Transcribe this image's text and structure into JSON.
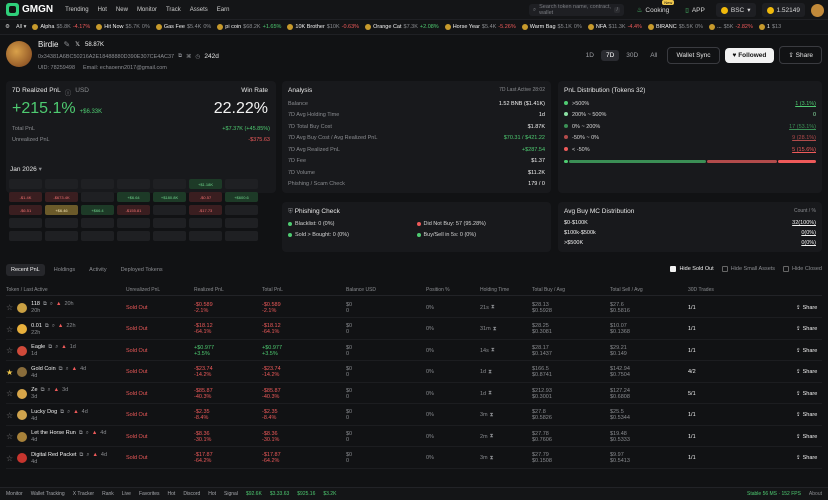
{
  "nav": {
    "brand": "GMGN",
    "links": [
      "Trending",
      "Hot",
      "New",
      "Monitor",
      "Track",
      "Assets",
      "Earn"
    ],
    "search_placeholder": "Search token name, contract, wallet",
    "search_shortcut": "/",
    "cooking_label": "Cooking",
    "cooking_badge": "New",
    "app_label": "APP",
    "chain": "BSC",
    "balance": "1.52149"
  },
  "ticker": {
    "filter_label": "All",
    "items": [
      {
        "name": "Alpha",
        "mc": "$5.8K",
        "chg": "-4.17%",
        "dir": "down"
      },
      {
        "name": "Hit Now",
        "mc": "$5.7K",
        "chg": "0%",
        "dir": "flat"
      },
      {
        "name": "Gas Fee",
        "mc": "$5.4K",
        "chg": "0%",
        "dir": "flat"
      },
      {
        "name": "pi coin",
        "mc": "$68.2K",
        "chg": "+1.65%",
        "dir": "up"
      },
      {
        "name": "10K Brother",
        "mc": "$10K",
        "chg": "-0.63%",
        "dir": "down"
      },
      {
        "name": "Orange Cat",
        "mc": "$7.3K",
        "chg": "+2.08%",
        "dir": "up"
      },
      {
        "name": "Horse Year",
        "mc": "$5.4K",
        "chg": "-5.26%",
        "dir": "down"
      },
      {
        "name": "Warm Bag",
        "mc": "$5.1K",
        "chg": "0%",
        "dir": "flat"
      },
      {
        "name": "NFA",
        "mc": "$11.3K",
        "chg": "-4.4%",
        "dir": "down"
      },
      {
        "name": "BIRANC",
        "mc": "$5.5K",
        "chg": "0%",
        "dir": "flat"
      },
      {
        "name": "...",
        "mc": "$5K",
        "chg": "-2.82%",
        "dir": "down"
      },
      {
        "name": "1",
        "mc": "$13",
        "chg": "",
        "dir": "flat"
      }
    ]
  },
  "profile": {
    "name": "Birdie",
    "followers": "58.87K",
    "age": "242d",
    "address": "0x34381A6BC50216A2E18488880D390E307CE4AC37",
    "uid": "UID: 78259498",
    "email": "Email: echaoenn2017@gmail.com",
    "timeframes": [
      "1D",
      "7D",
      "30D",
      "All"
    ],
    "tf_active": "7D",
    "wallet_sync_label": "Wallet Sync",
    "followed_label": "Followed",
    "share_label": "Share"
  },
  "pnl": {
    "title": "7D Realized PnL",
    "currency": "USD",
    "winrate_label": "Win Rate",
    "pct": "+215.1%",
    "usd": "+$6.33K",
    "winrate": "22.22%",
    "total_label": "Total PnL",
    "total_value": "+$7.37K (+45.85%)",
    "unreal_label": "Unrealized PnL",
    "unreal_value": "-$375.63"
  },
  "calendar": {
    "month": "Jan 2026",
    "cells": [
      "",
      "",
      "",
      "",
      "",
      "+$1.18K",
      "",
      "-$1.4K",
      "-$673.4K",
      "",
      "+$6.64",
      "+$180.8K",
      "-$0.57",
      "+$600.6",
      "-$6.51",
      "+$6.46",
      "+$66.4",
      "-$155.81",
      "",
      "-$17.73",
      "",
      "",
      "",
      "",
      "",
      "",
      "",
      "",
      "",
      "",
      "",
      "",
      "",
      "",
      ""
    ]
  },
  "analysis": {
    "title": "Analysis",
    "tf_label": "7D",
    "last_active": "Last Active 28:02",
    "rows": [
      {
        "label": "Balance",
        "value": "1.52 BNB ($1.41K)"
      },
      {
        "label": "7D Avg Holding Time",
        "value": "1d"
      },
      {
        "label": "7D Total Buy Cost",
        "value": "$1.87K"
      },
      {
        "label": "7D Avg Buy Cost / Avg Realized PnL",
        "value": "$70.31 / $421.22"
      },
      {
        "label": "7D Avg Realized PnL",
        "value": "+$287.54"
      },
      {
        "label": "7D Fee",
        "value": "$1.37"
      },
      {
        "label": "7D Volume",
        "value": "$11.2K"
      },
      {
        "label": "Phishing / Scam Check",
        "value": "179 / 0"
      }
    ]
  },
  "distribution": {
    "title": "PnL Distribution (Tokens 32)",
    "rows": [
      {
        "label": ">500%",
        "value": "1 (3.1%)",
        "color": "#4ecb71"
      },
      {
        "label": "200% ~ 500%",
        "value": "0",
        "color": "#8be0a3"
      },
      {
        "label": "0% ~ 200%",
        "value": "17 (53.1%)",
        "color": "#3b8f55"
      },
      {
        "label": "-50% ~ 0%",
        "value": "9 (28.1%)",
        "color": "#b24b4b"
      },
      {
        "label": "< -50%",
        "value": "5 (15.6%)",
        "color": "#ee5a5a"
      }
    ]
  },
  "phishing": {
    "title": "Phishing Check",
    "items": [
      {
        "label": "Blacklist: 0 (0%)",
        "color": "#4ecb71"
      },
      {
        "label": "Did Not Buy: 57 (95.28%)",
        "color": "#ee5a5a"
      },
      {
        "label": "Sold > Bought: 0 (0%)",
        "color": "#4ecb71"
      },
      {
        "label": "Buy/Sell in 5s: 0 (0%)",
        "color": "#4ecb71"
      }
    ]
  },
  "avgbuy": {
    "title": "Avg Buy MC Distribution",
    "count_label": "Count / %",
    "rows": [
      {
        "label": "$0-$100K",
        "value": "32(100%)"
      },
      {
        "label": "$100k-$500k",
        "value": "0(0%)"
      },
      {
        "label": ">$500K",
        "value": "0(0%)"
      }
    ]
  },
  "tabs": [
    "Recent PnL",
    "Holdings",
    "Activity",
    "Deployed Tokens"
  ],
  "filters": [
    "Hide Sold Out",
    "Hide Small Assets",
    "Hide Closed"
  ],
  "table": {
    "headers": [
      "Token / Last Active",
      "Unrealized PnL",
      "Realized PnL",
      "Total PnL",
      "Balance USD",
      "Position %",
      "Holding Time",
      "Total Buy / Avg",
      "Total Sell / Avg",
      "30D Trades",
      ""
    ],
    "rows": [
      {
        "name": "118",
        "age": "20h",
        "t": "20h",
        "unreal": "Sold Out",
        "real": "-$0.589",
        "real_pct": "-2.1%",
        "total": "-$0.589",
        "total_pct": "-2.1%",
        "bal": "$0",
        "bal2": "0",
        "pos": "0%",
        "hold": "21s",
        "buy": "$28.13",
        "buy_avg": "$0.5928",
        "sell": "$27.6",
        "sell_avg": "$0.5816",
        "trades": "1/1",
        "color": "#c9a043",
        "star": false
      },
      {
        "name": "0.01",
        "age": "22h",
        "t": "22h",
        "unreal": "Sold Out",
        "real": "-$18.12",
        "real_pct": "-64.1%",
        "total": "-$18.12",
        "total_pct": "-64.1%",
        "bal": "$0",
        "bal2": "0",
        "pos": "0%",
        "hold": "31m",
        "buy": "$28.25",
        "buy_avg": "$0.3081",
        "sell": "$10.07",
        "sell_avg": "$0.1368",
        "trades": "1/1",
        "color": "#e8b03c",
        "star": false
      },
      {
        "name": "Eagle",
        "age": "1d",
        "t": "1d",
        "unreal": "Sold Out",
        "real": "+$0.977",
        "real_pct": "+3.5%",
        "total": "+$0.977",
        "total_pct": "+3.5%",
        "bal": "$0",
        "bal2": "0",
        "pos": "0%",
        "hold": "14s",
        "buy": "$28.17",
        "buy_avg": "$0.1437",
        "sell": "$29.21",
        "sell_avg": "$0.149",
        "trades": "1/1",
        "color": "#d04a3a",
        "star": false
      },
      {
        "name": "Gold Coin",
        "age": "4d",
        "t": "4d",
        "unreal": "Sold Out",
        "real": "-$23.74",
        "real_pct": "-14.2%",
        "total": "-$23.74",
        "total_pct": "-14.2%",
        "bal": "$0",
        "bal2": "0",
        "pos": "0%",
        "hold": "1d",
        "buy": "$166.5",
        "buy_avg": "$0.8741",
        "sell": "$142.94",
        "sell_avg": "$0.7504",
        "trades": "4/2",
        "color": "#8a6d3b",
        "star": true
      },
      {
        "name": "Ze",
        "age": "3d",
        "t": "3d",
        "unreal": "Sold Out",
        "real": "-$85.87",
        "real_pct": "-40.3%",
        "total": "-$85.87",
        "total_pct": "-40.3%",
        "bal": "$0",
        "bal2": "0",
        "pos": "0%",
        "hold": "1d",
        "buy": "$212.93",
        "buy_avg": "$0.3001",
        "sell": "$127.24",
        "sell_avg": "$0.6808",
        "trades": "5/1",
        "color": "#d8a64a",
        "star": false
      },
      {
        "name": "Lucky Dog",
        "age": "4d",
        "t": "4d",
        "unreal": "Sold Out",
        "real": "-$2.35",
        "real_pct": "-8.4%",
        "total": "-$2.35",
        "total_pct": "-8.4%",
        "bal": "$0",
        "bal2": "0",
        "pos": "0%",
        "hold": "3m",
        "buy": "$27.8",
        "buy_avg": "$0.5826",
        "sell": "$25.5",
        "sell_avg": "$0.5344",
        "trades": "1/1",
        "color": "#cfa34d",
        "star": false
      },
      {
        "name": "Let the Horse Run",
        "age": "4d",
        "t": "4d",
        "unreal": "Sold Out",
        "real": "-$8.36",
        "real_pct": "-30.1%",
        "total": "-$8.36",
        "total_pct": "-30.1%",
        "bal": "$0",
        "bal2": "0",
        "pos": "0%",
        "hold": "2m",
        "buy": "$27.78",
        "buy_avg": "$0.7606",
        "sell": "$19.48",
        "sell_avg": "$0.5333",
        "trades": "1/1",
        "color": "#a8823a",
        "star": false
      },
      {
        "name": "Digital Red Packet",
        "age": "4d",
        "t": "4d",
        "unreal": "Sold Out",
        "real": "-$17.87",
        "real_pct": "-64.2%",
        "total": "-$17.87",
        "total_pct": "-64.2%",
        "bal": "$0",
        "bal2": "0",
        "pos": "0%",
        "hold": "3m",
        "buy": "$27.79",
        "buy_avg": "$0.1508",
        "sell": "$9.97",
        "sell_avg": "$0.5413",
        "trades": "1/1",
        "color": "#c7352e",
        "star": false
      }
    ],
    "share_label": "Share"
  },
  "bottombar": {
    "items": [
      "Monitor",
      "Wallet Tracking",
      "X Tracker",
      "Rank",
      "Live",
      "Favorites",
      "Hot",
      "Discord",
      "Hot",
      "Signal"
    ],
    "prices": [
      "$92.6K",
      "$3.33.63",
      "$925.16",
      "$3.2K"
    ],
    "status": "Stable 56 MS · 152 FPS",
    "about": "About"
  }
}
